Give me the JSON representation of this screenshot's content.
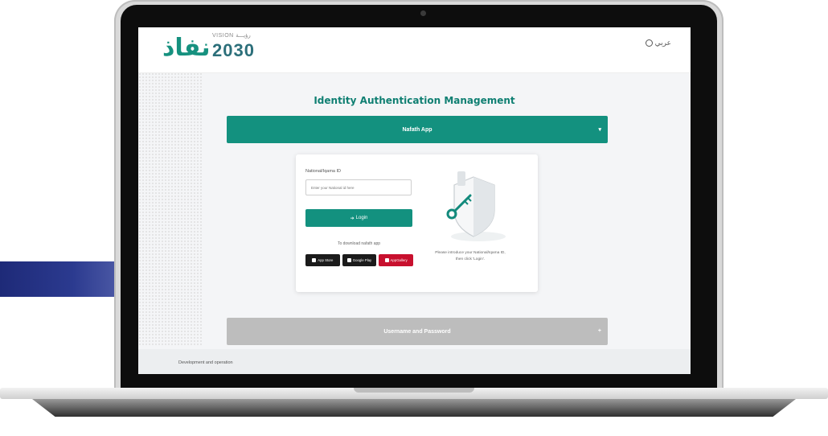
{
  "header": {
    "logo_text": "نفاذ",
    "vision_label": "VISION رؤيـــة",
    "vision_year": "2030",
    "language_label": "عربي"
  },
  "page": {
    "title": "Identity Authentication Management"
  },
  "accordion": {
    "nafath_app": {
      "label": "Nafath App",
      "state": "expanded"
    },
    "username_password": {
      "label": "Username and Password",
      "state": "collapsed"
    }
  },
  "login_card": {
    "id_label": "National/Iqama ID",
    "id_placeholder": "Enter your National id here",
    "login_button": "Login",
    "download_text": "To download nafath app",
    "stores": [
      {
        "name": "App Store",
        "icon": "apple-icon"
      },
      {
        "name": "Google Play",
        "icon": "google-play-icon"
      },
      {
        "name": "AppGallery",
        "icon": "huawei-icon"
      }
    ],
    "hint_line1": "Please introduce your National/Iqama ID,",
    "hint_line2": "then click 'Login'."
  },
  "footer": {
    "text": "Development and operation"
  },
  "colors": {
    "primary": "#13917f",
    "title": "#0f7f72",
    "collapsed": "#bdbdbd"
  }
}
